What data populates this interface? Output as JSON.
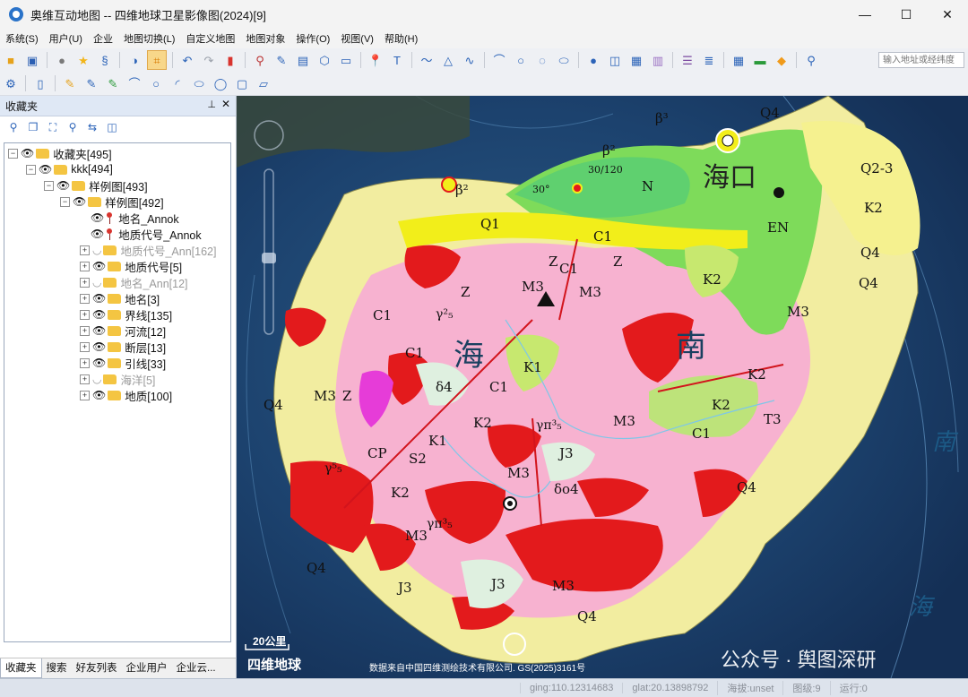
{
  "window": {
    "title": "奥维互动地图 -- 四维地球卫星影像图(2024)[9]",
    "buttons": {
      "minimize": "—",
      "maximize": "☐",
      "close": "✕"
    }
  },
  "menu": [
    "系统(S)",
    "用户(U)",
    "企业",
    "地图切换(L)",
    "自定义地图",
    "地图对象",
    "操作(O)",
    "视图(V)",
    "帮助(H)"
  ],
  "toolbar": {
    "search_placeholder": "输入地址或经纬度"
  },
  "sidebar": {
    "title": "收藏夹",
    "tree": [
      {
        "label": "收藏夹[495]"
      },
      {
        "label": "kkk[494]"
      },
      {
        "label": "样例图[493]"
      },
      {
        "label": "样例图[492]"
      },
      {
        "label": "地名_Annok"
      },
      {
        "label": "地质代号_Annok"
      },
      {
        "label": "地质代号_Ann[162]"
      },
      {
        "label": "地质代号[5]"
      },
      {
        "label": "地名_Ann[12]"
      },
      {
        "label": "地名[3]"
      },
      {
        "label": "界线[135]"
      },
      {
        "label": "河流[12]"
      },
      {
        "label": "断层[13]"
      },
      {
        "label": "引线[33]"
      },
      {
        "label": "海洋[5]"
      },
      {
        "label": "地质[100]"
      }
    ],
    "tabs": [
      "收藏夹",
      "搜索",
      "好友列表",
      "企业用户",
      "企业云..."
    ]
  },
  "map": {
    "place_labels": [
      "海口",
      "海",
      "南",
      "南",
      "海"
    ],
    "scale": "20公里",
    "logo": "四维地球",
    "copyright": "数据来自中国四维测绘技术有限公司. GS(2025)3161号",
    "watermark": "公众号 · 舆图深研",
    "geo_codes": [
      "Q1",
      "Q4",
      "β²",
      "β²",
      "β³",
      "N",
      "EN",
      "C1",
      "C1",
      "C1",
      "C1",
      "C1",
      "C1",
      "Z",
      "Z",
      "Z",
      "Z",
      "M3",
      "M3",
      "M3",
      "M3",
      "M3",
      "M3",
      "M3",
      "M3",
      "K1",
      "K1",
      "K2",
      "K2",
      "K2",
      "K2",
      "K2",
      "K2",
      "J3",
      "J3",
      "J3",
      "S2",
      "CP",
      "T3",
      "Q2-3",
      "Q4",
      "Q4",
      "Q4",
      "Q4",
      "Q4",
      "Q4",
      "δ4",
      "δo4",
      "γ⁵₅",
      "γπ³₅",
      "γπ³₅",
      "γ²₅",
      "30/120",
      "30°"
    ]
  },
  "status": {
    "lng": "ging:110.12314683",
    "lat": "glat:20.13898792",
    "altitude": "海拔:unset",
    "level": "图级:9",
    "running": "运行:0"
  }
}
